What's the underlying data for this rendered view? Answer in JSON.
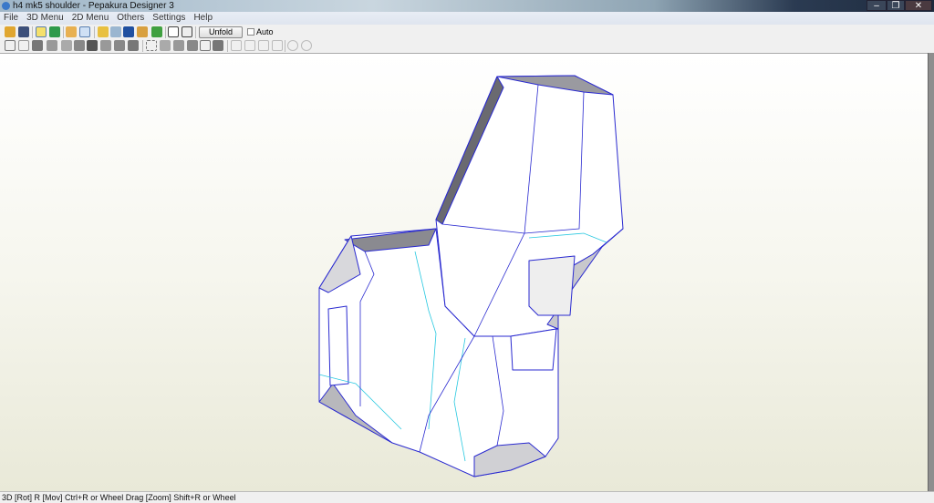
{
  "window": {
    "title": "h4 mk5 shoulder - Pepakura Designer 3",
    "minimize": "–",
    "maximize": "❐",
    "close": "✕"
  },
  "menu": [
    "File",
    "3D Menu",
    "2D Menu",
    "Others",
    "Settings",
    "Help"
  ],
  "toolbar": {
    "unfold_label": "Unfold",
    "auto_label": "Auto"
  },
  "status": {
    "text": "3D [Rot] R [Mov] Ctrl+R or Wheel Drag [Zoom] Shift+R or Wheel"
  },
  "colors": {
    "edge": "#2a2ad0",
    "fold": "#28c8e0",
    "face": "#ffffff",
    "shade": "#b8b8bc"
  }
}
